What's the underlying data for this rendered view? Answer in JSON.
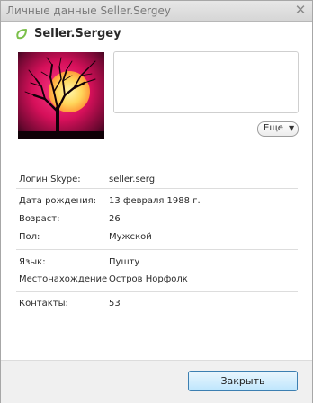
{
  "window": {
    "title": "Личные данные Seller.Sergey",
    "close_glyph": "✕"
  },
  "profile": {
    "status_icon": "online-status-icon",
    "status_color": "#7cc04b",
    "display_name": "Seller.Sergey",
    "avatar": "tree-moon-silhouette",
    "more_label": "Еще",
    "more_arrow": "▼"
  },
  "details": {
    "skype_login": {
      "label": "Логин Skype:",
      "value": "seller.serg"
    },
    "birth_date": {
      "label": "Дата рождения:",
      "value": "13 февраля 1988 г."
    },
    "age": {
      "label": "Возраст:",
      "value": "26"
    },
    "gender": {
      "label": "Пол:",
      "value": "Мужской"
    },
    "language": {
      "label": "Язык:",
      "value": "Пушту"
    },
    "location": {
      "label": "Местонахождение",
      "value": "Остров Норфолк"
    },
    "contacts": {
      "label": "Контакты:",
      "value": "53"
    }
  },
  "footer": {
    "close_label": "Закрыть"
  }
}
